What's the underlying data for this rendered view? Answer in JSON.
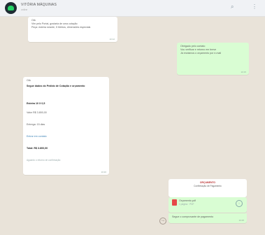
{
  "header": {
    "contact_name": "VITÓRIA MÁQUINAS",
    "contact_status": "online",
    "search_icon": "search-icon",
    "menu_icon": "more-vert-icon"
  },
  "messages": [
    {
      "direction": "in",
      "lines": [
        "Olá",
        "Vim pelo Portal, gostaria de uma cotação",
        "Peça: esteira rolante, 5 Metros, dimensões especiais"
      ],
      "time": "10:12"
    },
    {
      "direction": "out",
      "lines": [
        "Obrigado pelo contato",
        "Vou verificar e retorno em breve",
        "Já enviamos o orçamento por e-mail"
      ],
      "time": "10:15"
    },
    {
      "direction": "in",
      "lines": [
        "Olá",
        "Segue dados do Pedido de Cotação e orçamento",
        "Esteira 10 X 0,5",
        "Valor R$ 3.800,00",
        "Entrega: 15 dias",
        "Entrar em contato",
        "Total: R$ 3.800,00",
        "Aguardo o retorno de confirmação"
      ],
      "time": "10:20"
    },
    {
      "direction": "out",
      "type": "document",
      "title": "ORÇAMENTO",
      "subtitle": "Confirmação de Pagamento",
      "file_name": "Orçamento.pdf",
      "file_info": "1 página · PDF",
      "caption": "Segue o comprovante de pagamento",
      "time": "10:25"
    }
  ]
}
